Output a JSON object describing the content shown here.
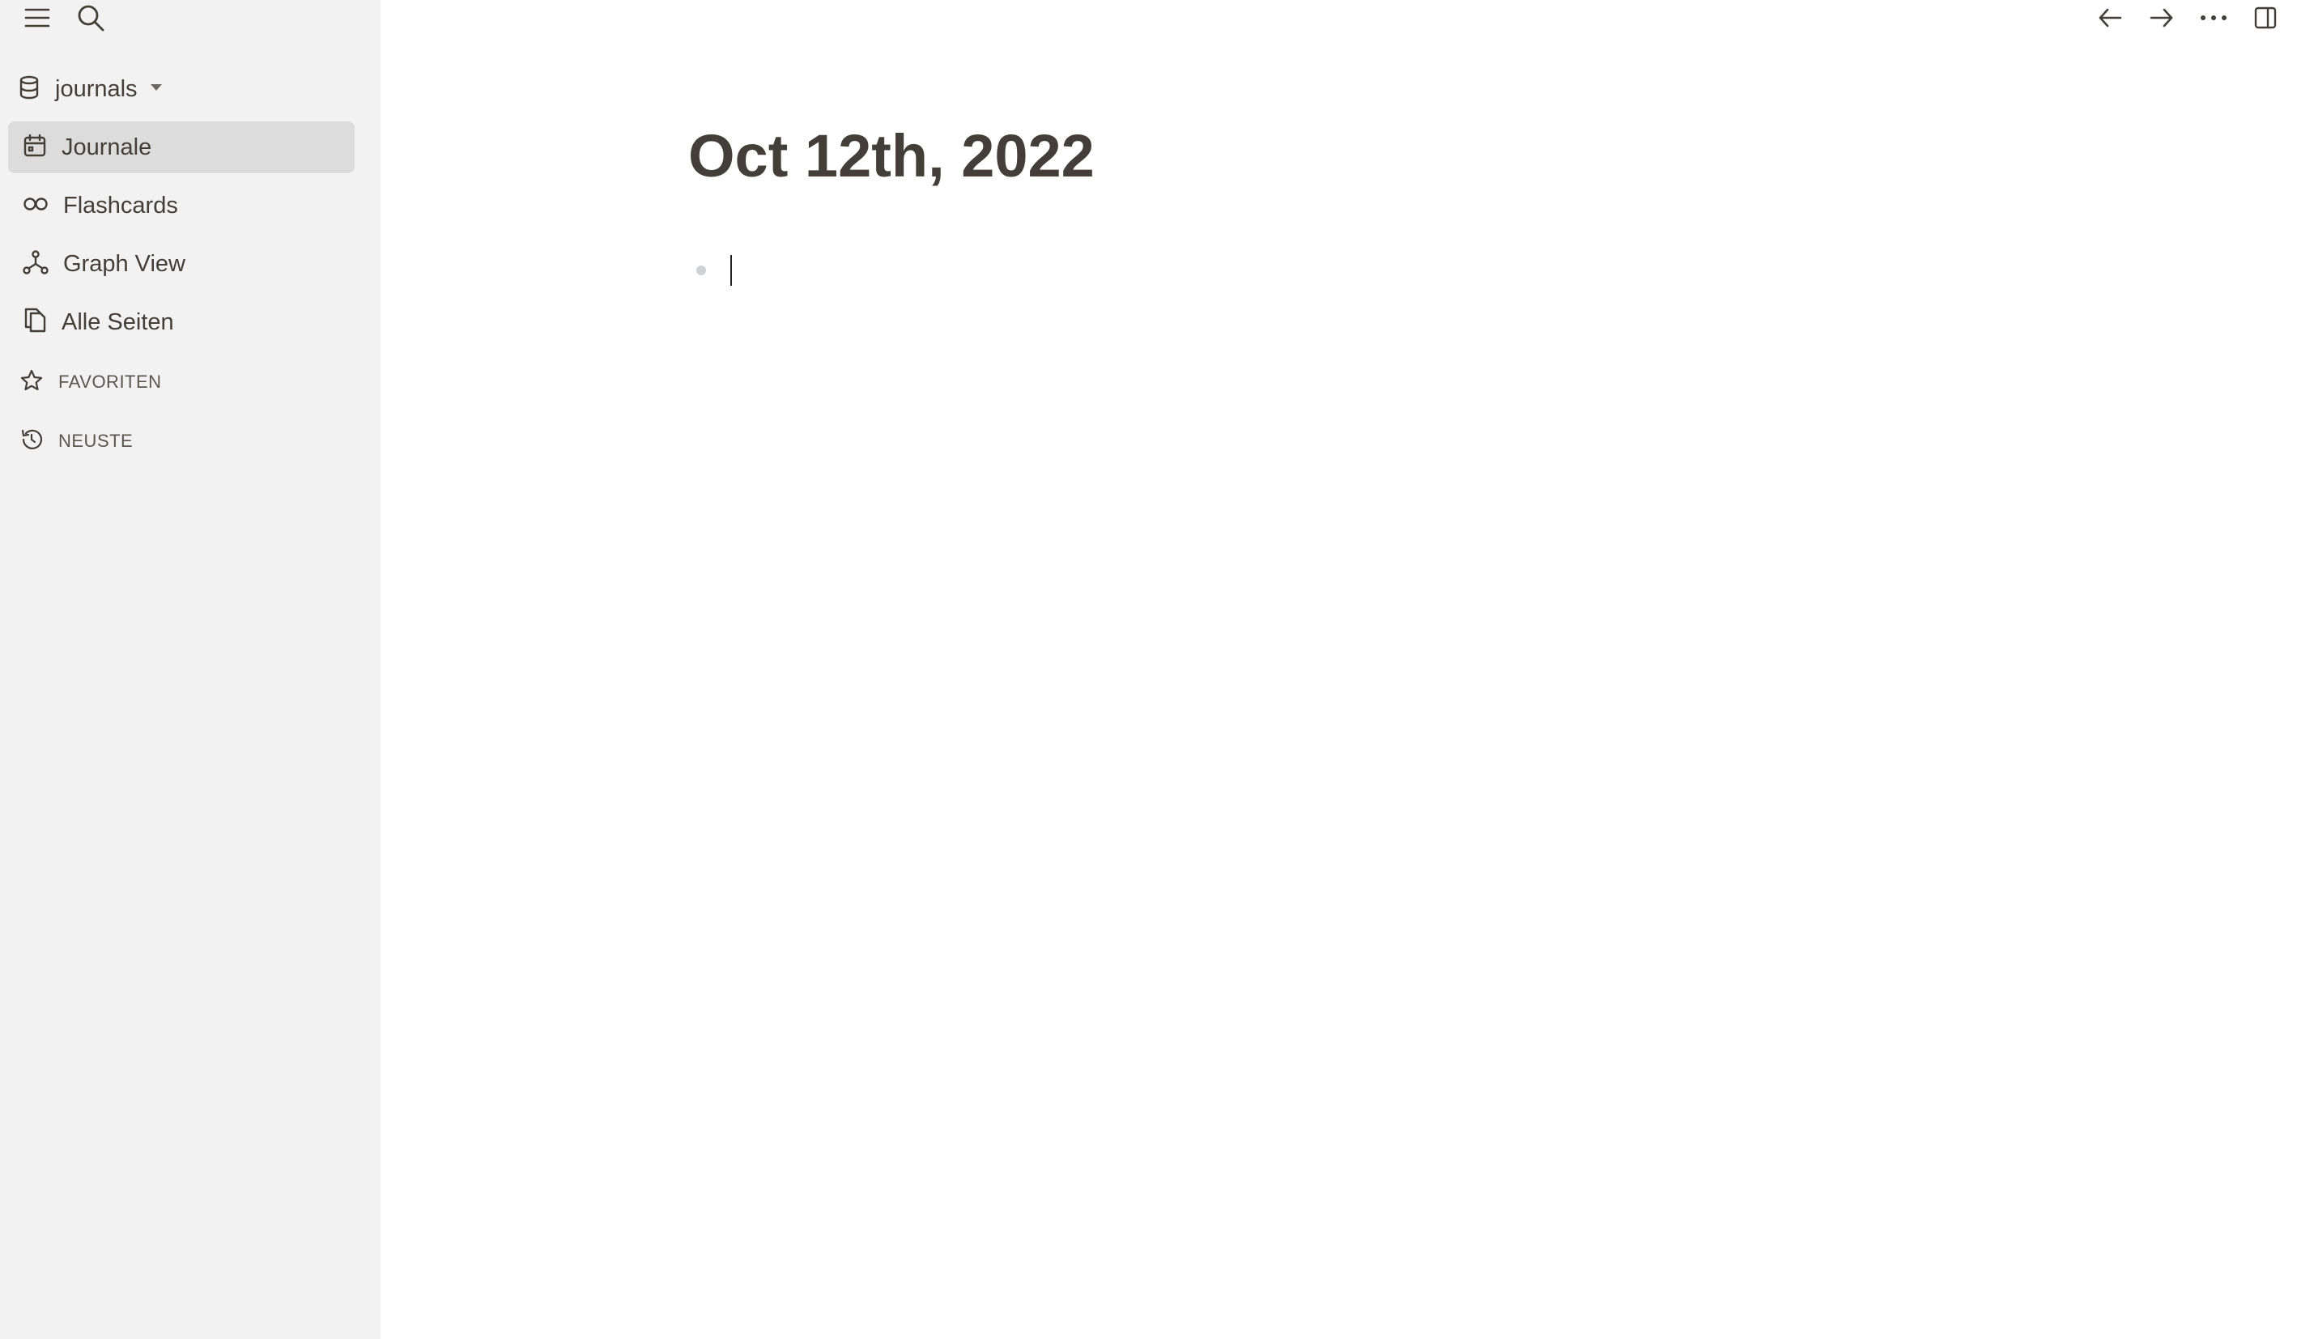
{
  "sidebar": {
    "graph": {
      "name": "journals",
      "icon": "database-icon"
    },
    "nav": [
      {
        "label": "Journale",
        "icon": "calendar-icon",
        "active": true
      },
      {
        "label": "Flashcards",
        "icon": "infinity-icon",
        "active": false
      },
      {
        "label": "Graph View",
        "icon": "graph-icon",
        "active": false
      },
      {
        "label": "Alle Seiten",
        "icon": "pages-icon",
        "active": false
      }
    ],
    "sections": [
      {
        "label": "FAVORITEN",
        "icon": "star-icon"
      },
      {
        "label": "NEUSTE",
        "icon": "history-icon"
      }
    ]
  },
  "toolbar": {
    "left": [
      "menu-icon",
      "search-icon"
    ],
    "right": [
      "arrow-left-icon",
      "arrow-right-icon",
      "more-icon",
      "sidebar-toggle-icon"
    ]
  },
  "page": {
    "title": "Oct 12th, 2022",
    "block_text": ""
  },
  "colors": {
    "sidebar_bg": "#f2f2f2",
    "active_item_bg": "#dcdcdc",
    "text": "#433f38",
    "bullet": "#cfd2d4"
  }
}
